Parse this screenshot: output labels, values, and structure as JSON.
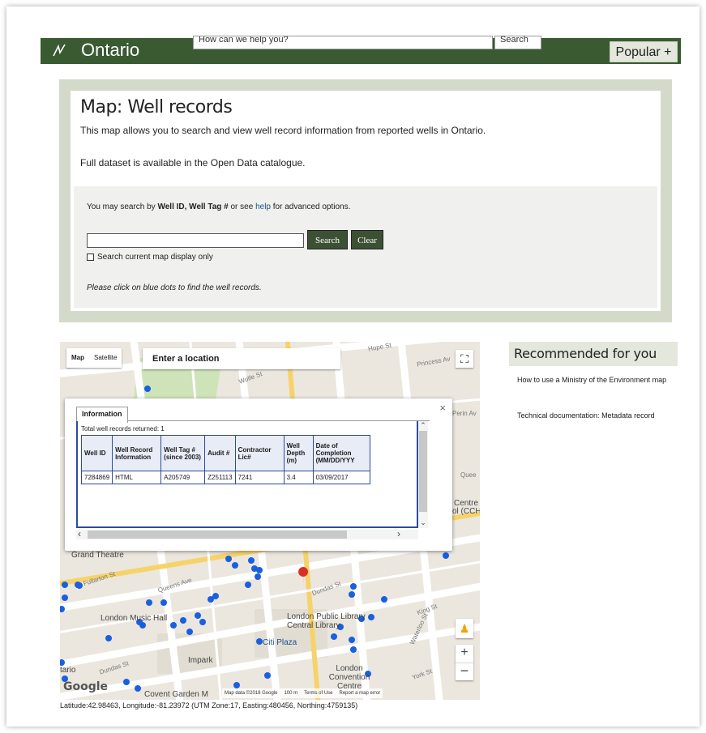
{
  "header": {
    "logo_text": "Ontario",
    "search_placeholder": "How can we help you?",
    "search_button": "Search",
    "popular_button": "Popular +"
  },
  "main": {
    "title": "Map: Well records",
    "description": "This map allows you to search and view well record information from reported wells in Ontario.",
    "dataset_text": "Full dataset is available in the Open Data catalogue.",
    "search": {
      "help_prefix": "You may search by ",
      "help_well_id": "Well ID, Well Tag #",
      "help_middle": " or see ",
      "help_link": "help",
      "help_suffix": " for advanced options.",
      "input_value": "",
      "search_button": "Search",
      "clear_button": "Clear",
      "checkbox_label": "Search current map display only",
      "hint": "Please click on blue dots to find the well records."
    }
  },
  "map": {
    "maptype_map": "Map",
    "maptype_satellite": "Satellite",
    "location_placeholder": "Enter a location",
    "google": "Google",
    "footer": {
      "map_data": "Map data ©2018 Google",
      "scale": "100 m",
      "terms": "Terms of Use",
      "report": "Report a map error"
    },
    "labels": {
      "grand_theatre": "Grand Theatre",
      "fullarton": "Fullarton St",
      "queens": "Queens Ave",
      "music_hall": "London Music Hall",
      "public_library": "London Public Library Central Library",
      "citi_plaza": "Citi Plaza",
      "impark": "Impark",
      "convention": "London Convention Centre",
      "dundas1": "Dundas St",
      "dundas2": "Dundas St",
      "king": "King St",
      "waterloo": "Waterloo St",
      "york": "York St",
      "princess": "Princess Av",
      "wolfe": "Wolfe St",
      "ontario_left": "tario",
      "covent": "Covent Garden M",
      "centre": "Centre",
      "cch": "ol (CCH",
      "queens_right": "Quee",
      "waterin": "Perin Av",
      "hope": "Hope St"
    },
    "popup": {
      "tab": "Information",
      "total": "Total well records returned: 1",
      "columns": [
        "Well ID",
        "Well Record Information",
        "Well Tag # (since 2003)",
        "Audit #",
        "Contractor Lic#",
        "Well Depth (m)",
        "Date of Completion (MM/DD/YYY"
      ],
      "rows": [
        [
          "7284869",
          "HTML",
          "A205749",
          "Z251113",
          "7241",
          "3.4",
          "03/09/2017"
        ]
      ]
    },
    "coordinates": "Latitude:42.98463, Longitude:-81.23972 (UTM Zone:17, Easting:480456, Northing:4759135)"
  },
  "recommended": {
    "title": "Recommended for you",
    "links": [
      "How to use a Ministry of the Environment map",
      "Technical documentation: Metadata record"
    ]
  },
  "colors": {
    "header_green": "#3a5a32",
    "panel_bg": "#d3dac9",
    "button_dark": "#3c5133",
    "table_border": "#2e4b9c",
    "well_dot": "#1a5fe0"
  }
}
